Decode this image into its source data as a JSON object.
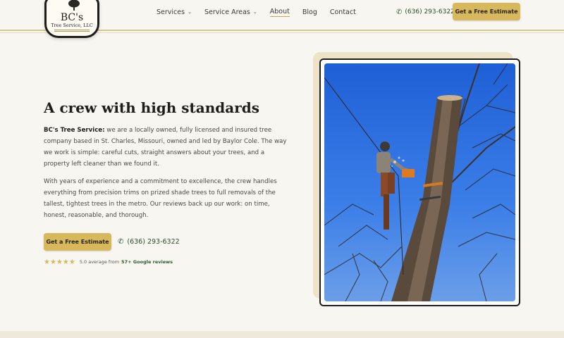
{
  "header": {
    "logo": {
      "name": "BC's",
      "sub": "Tree Service, LLC"
    },
    "nav": [
      {
        "label": "Services",
        "dropdown": true
      },
      {
        "label": "Service Areas",
        "dropdown": true
      },
      {
        "label": "About",
        "active": true
      },
      {
        "label": "Blog"
      },
      {
        "label": "Contact"
      }
    ],
    "phone": "(636) 293-6322",
    "cta": "Get a Free Estimate"
  },
  "hero": {
    "title": "A crew with high standards",
    "para1_lead": "BC's Tree Service:",
    "para1_rest": " we are a locally owned, fully licensed and insured tree company based in St. Charles, Missouri, owned and led by Baylor Cole. The way we work is simple: careful cuts, straight answers about your trees, and a property left cleaner than we found it.",
    "para2": "With years of experience and a commitment to excellence, the crew handles everything from precision trims on prized shade trees to full removals of the tallest, tightest trees in the metro. Our reviews back up our work: on time, honest, reasonable, and thorough.",
    "cta": "Get a Free Estimate",
    "phone": "(636) 293-6322",
    "rating": {
      "stars": "★★★★★",
      "text": "5.0 average from",
      "link": "57+ Google reviews"
    }
  },
  "colors": {
    "gold": "#d8b85c",
    "green": "#2e5a2e",
    "ink": "#1f1d1a",
    "sky": "#2a6fe0"
  },
  "icons": {
    "phone": "phone-icon",
    "chevron": "chevron-down-icon",
    "star": "star-icon"
  }
}
